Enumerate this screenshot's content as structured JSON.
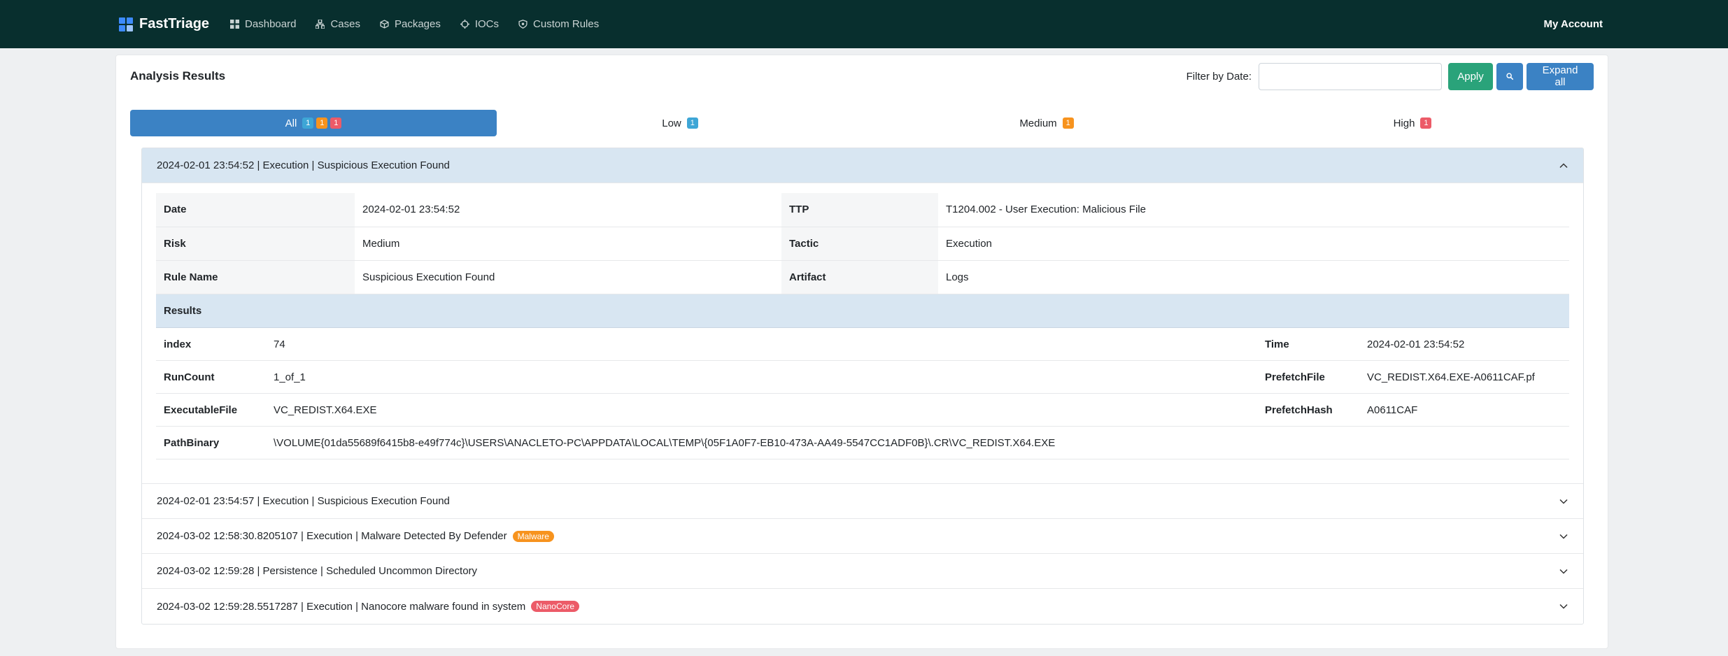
{
  "nav": {
    "brand": "FastTriage",
    "links": [
      {
        "label": "Dashboard",
        "icon": "dashboard-icon"
      },
      {
        "label": "Cases",
        "icon": "sitemap-icon"
      },
      {
        "label": "Packages",
        "icon": "cube-icon"
      },
      {
        "label": "IOCs",
        "icon": "crosshair-icon"
      },
      {
        "label": "Custom Rules",
        "icon": "shield-icon"
      }
    ],
    "account": "My Account"
  },
  "card": {
    "title": "Analysis Results",
    "filter_label": "Filter by Date:",
    "date_value": "",
    "apply": "Apply",
    "expand_all": "Expand all"
  },
  "tabs": {
    "all": {
      "label": "All",
      "low": "1",
      "med": "1",
      "high": "1"
    },
    "low": {
      "label": "Low",
      "count": "1"
    },
    "medium": {
      "label": "Medium",
      "count": "1"
    },
    "high": {
      "label": "High",
      "count": "1"
    }
  },
  "items": [
    {
      "header": "2024-02-01 23:54:52 | Execution | Suspicious Execution Found",
      "tag": ""
    },
    {
      "header": "2024-02-01 23:54:57 | Execution | Suspicious Execution Found",
      "tag": ""
    },
    {
      "header": "2024-03-02 12:58:30.8205107 | Execution | Malware Detected By Defender",
      "tag": "Malware"
    },
    {
      "header": "2024-03-02 12:59:28 | Persistence | Scheduled Uncommon Directory",
      "tag": ""
    },
    {
      "header": "2024-03-02 12:59:28.5517287 | Execution | Nanocore malware found in system",
      "tag": "NanoCore"
    }
  ],
  "detail": {
    "date_label": "Date",
    "date": "2024-02-01 23:54:52",
    "ttp_label": "TTP",
    "ttp": "T1204.002 - User Execution: Malicious File",
    "risk_label": "Risk",
    "risk": "Medium",
    "tactic_label": "Tactic",
    "tactic": "Execution",
    "rule_label": "Rule Name",
    "rule": "Suspicious Execution Found",
    "artifact_label": "Artifact",
    "artifact": "Logs",
    "results_label": "Results",
    "results": {
      "index_label": "index",
      "index": "74",
      "time_label": "Time",
      "time": "2024-02-01 23:54:52",
      "runcount_label": "RunCount",
      "runcount": "1_of_1",
      "prefetchfile_label": "PrefetchFile",
      "prefetchfile": "VC_REDIST.X64.EXE-A0611CAF.pf",
      "exec_label": "ExecutableFile",
      "exec": "VC_REDIST.X64.EXE",
      "prefetchhash_label": "PrefetchHash",
      "prefetchhash": "A0611CAF",
      "path_label": "PathBinary",
      "path": "\\VOLUME{01da55689f6415b8-e49f774c}\\USERS\\ANACLETO-PC\\APPDATA\\LOCAL\\TEMP\\{05F1A0F7-EB10-473A-AA49-5547CC1ADF0B}\\.CR\\VC_REDIST.X64.EXE"
    }
  }
}
